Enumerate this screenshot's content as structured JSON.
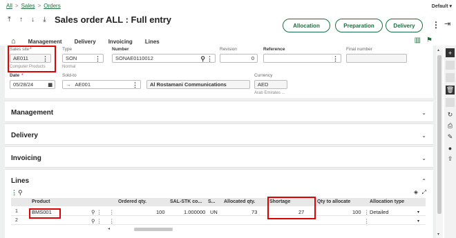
{
  "breadcrumbs": [
    "All",
    "Sales",
    "Orders"
  ],
  "default_menu": "Default",
  "title": "Sales order ALL : Full entry",
  "actions": [
    "Allocation",
    "Preparation",
    "Delivery"
  ],
  "tabs": [
    "Management",
    "Delivery",
    "Invoicing",
    "Lines"
  ],
  "header": {
    "sales_site_label": "Sales site",
    "sales_site_value": "AE011",
    "sales_site_sub": "Computer Products",
    "type_label": "Type",
    "type_value": "SON",
    "type_sub": "Normal",
    "number_label": "Number",
    "number_value": "SONAE0110012",
    "revision_label": "Revision",
    "revision_value": "0",
    "reference_label": "Reference",
    "reference_value": "",
    "final_number_label": "Final number",
    "final_number_value": "",
    "date_label": "Date",
    "date_value": "05/28/24",
    "soldto_label": "Sold-to",
    "soldto_value": "AE001",
    "soldto_name": "Al Rostamani Communications",
    "currency_label": "Currency",
    "currency_value": "AED",
    "currency_sub": "Arab Emirates ..."
  },
  "sections": [
    "Management",
    "Delivery",
    "Invoicing",
    "Lines"
  ],
  "grid": {
    "columns": [
      "Product",
      "Ordered qty.",
      "SAL-STK co...",
      "S...",
      "Allocated qty.",
      "Shortage",
      "Qty to allocate",
      "Allocation type"
    ],
    "rows": [
      {
        "num": "1",
        "product": "BMS001",
        "ordered": "100",
        "conv": "1.000000",
        "unit": "UN",
        "allocated": "73",
        "shortage": "27",
        "to_allocate": "100",
        "alloc_type": "Detailed"
      },
      {
        "num": "2",
        "product": "",
        "ordered": "",
        "conv": "",
        "unit": "",
        "allocated": "",
        "shortage": "",
        "to_allocate": "",
        "alloc_type": ""
      }
    ]
  },
  "colors": {
    "accent": "#1a6d3c",
    "highlight": "#dd0000",
    "toolbar_dark": "#333333"
  }
}
